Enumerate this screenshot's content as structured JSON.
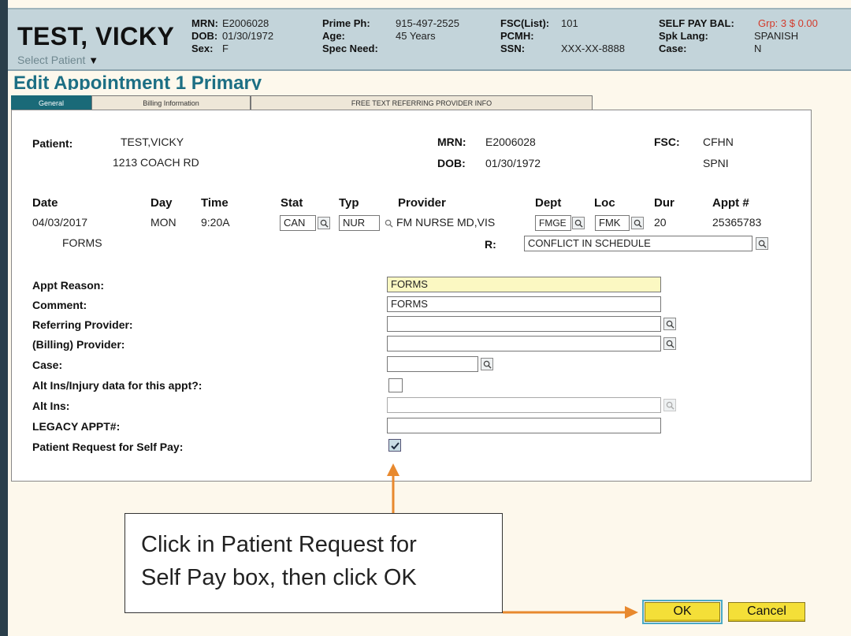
{
  "header": {
    "patient_name": "TEST, VICKY",
    "select_patient": "Select Patient",
    "mrn_label": "MRN:",
    "mrn": "E2006028",
    "dob_label": "DOB:",
    "dob": "01/30/1972",
    "sex_label": "Sex:",
    "sex": "F",
    "prime_ph_label": "Prime Ph:",
    "prime_ph": "915-497-2525",
    "age_label": "Age:",
    "age": "45 Years",
    "spec_need_label": "Spec Need:",
    "fsc_list_label": "FSC(List):",
    "fsc_list": "101",
    "pcmh_label": "PCMH:",
    "ssn_label": "SSN:",
    "ssn": "XXX-XX-8888",
    "self_pay_bal_label": "SELF PAY BAL:",
    "self_pay_bal": "Grp: 3 $ 0.00",
    "spk_lang_label": "Spk Lang:",
    "spk_lang": "SPANISH",
    "case_label": "Case:",
    "case": "N"
  },
  "page_title": "Edit Appointment 1 Primary",
  "tabs": [
    "General",
    "Billing Information",
    "FREE TEXT REFERRING PROVIDER INFO"
  ],
  "patient_block": {
    "patient_label": "Patient:",
    "patient_name": "TEST,VICKY",
    "address": "1213 COACH RD",
    "mrn_label": "MRN:",
    "mrn": "E2006028",
    "dob_label": "DOB:",
    "dob": "01/30/1972",
    "fsc_label": "FSC:",
    "fsc": "CFHN",
    "fsc2": "SPNI"
  },
  "appt_headers": {
    "date": "Date",
    "day": "Day",
    "time": "Time",
    "stat": "Stat",
    "typ": "Typ",
    "provider": "Provider",
    "dept": "Dept",
    "loc": "Loc",
    "dur": "Dur",
    "appt_no": "Appt #"
  },
  "appt_row": {
    "date": "04/03/2017",
    "day": "MON",
    "time": "9:20A",
    "stat": "CAN",
    "typ": "NUR",
    "provider": "FM NURSE MD,VIS",
    "dept": "FMGE",
    "loc": "FMK",
    "dur": "20",
    "appt_no": "25365783",
    "sub_reason": "FORMS",
    "r_label": "R:",
    "r_value": "CONFLICT IN SCHEDULE"
  },
  "form": {
    "appt_reason_label": "Appt Reason:",
    "appt_reason": "FORMS",
    "comment_label": "Comment:",
    "comment": "FORMS",
    "referring_provider_label": "Referring Provider:",
    "billing_provider_label": "(Billing) Provider:",
    "case_label": "Case:",
    "alt_ins_injury_label": "Alt Ins/Injury data for this appt?:",
    "alt_ins_label": "Alt Ins:",
    "legacy_appt_label": "LEGACY APPT#:",
    "self_pay_label": "Patient Request for Self Pay:",
    "self_pay_checked": true
  },
  "callout": {
    "line1": "Click in Patient Request for",
    "line2": "Self Pay box, then click OK"
  },
  "buttons": {
    "ok": "OK",
    "cancel": "Cancel"
  },
  "colors": {
    "title": "#1c6f84",
    "header_bg": "#c3d4da",
    "button": "#f4df38",
    "arrow": "#e8892e",
    "self_pay_bal": "#d33a2b"
  }
}
